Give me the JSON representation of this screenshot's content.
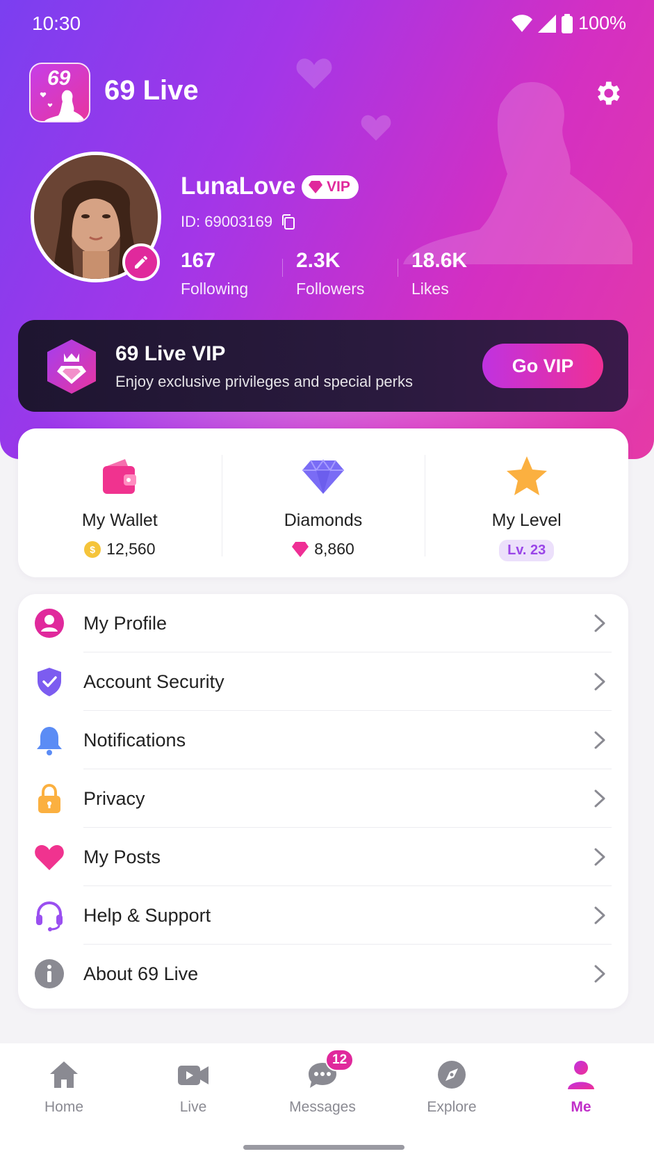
{
  "status_bar": {
    "time": "10:30",
    "battery": "100%"
  },
  "header": {
    "app_name": "69 Live",
    "logo_text": "69"
  },
  "profile": {
    "username": "LunaLove",
    "vip_badge": "VIP",
    "id_text": "ID: 69003169",
    "stats": [
      {
        "value": "167",
        "label": "Following"
      },
      {
        "value": "2.3K",
        "label": "Followers"
      },
      {
        "value": "18.6K",
        "label": "Likes"
      }
    ]
  },
  "vip_banner": {
    "title": "69 Live VIP",
    "subtitle": "Enjoy exclusive privileges and special perks",
    "button": "Go VIP"
  },
  "assets": [
    {
      "name": "My Wallet",
      "value": "12,560",
      "icon": "wallet-icon"
    },
    {
      "name": "Diamonds",
      "value": "8,860",
      "icon": "diamond-icon"
    },
    {
      "name": "My Level",
      "value": "Lv. 23",
      "icon": "star-icon"
    }
  ],
  "menu": [
    {
      "label": "My Profile",
      "icon": "user-icon"
    },
    {
      "label": "Account Security",
      "icon": "shield-icon"
    },
    {
      "label": "Notifications",
      "icon": "bell-icon"
    },
    {
      "label": "Privacy",
      "icon": "lock-icon"
    },
    {
      "label": "My Posts",
      "icon": "heart-icon"
    },
    {
      "label": "Help & Support",
      "icon": "headset-icon"
    },
    {
      "label": "About 69 Live",
      "icon": "info-icon"
    }
  ],
  "bottom_nav": [
    {
      "label": "Home",
      "icon": "home-icon"
    },
    {
      "label": "Live",
      "icon": "video-icon"
    },
    {
      "label": "Messages",
      "icon": "chat-icon",
      "badge": "12"
    },
    {
      "label": "Explore",
      "icon": "compass-icon"
    },
    {
      "label": "Me",
      "icon": "person-icon",
      "active": true
    }
  ],
  "colors": {
    "accent": "#e0299c",
    "purple": "#7b3ff0",
    "active_nav": "#c02fc8"
  }
}
